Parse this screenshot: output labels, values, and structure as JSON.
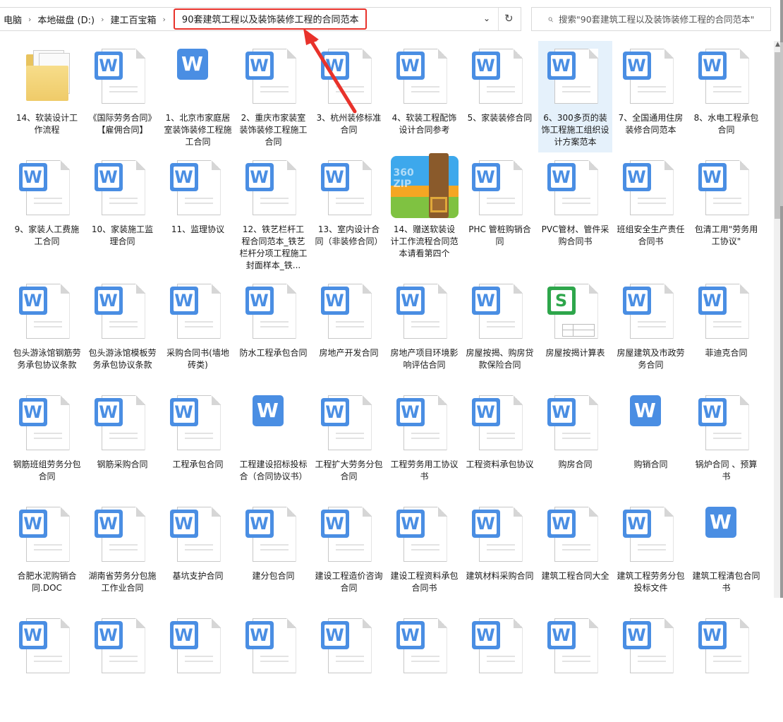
{
  "breadcrumb": [
    {
      "label": "电脑"
    },
    {
      "label": "本地磁盘 (D:)"
    },
    {
      "label": "建工百宝箱"
    }
  ],
  "current_folder": "90套建筑工程以及装饰装修工程的合同范本",
  "search": {
    "placeholder": "搜索\"90套建筑工程以及装饰装修工程的合同范本\""
  },
  "colors": {
    "word_blue": "#4a8ee3",
    "sheet_green": "#2ea64b",
    "highlight_red": "#e8322b",
    "selection": "#e5f1fb"
  },
  "icons": {
    "refresh": "refresh-icon",
    "search": "search-icon",
    "dropdown": "chevron-down-icon"
  },
  "files": [
    {
      "name": "14、软装设计工作流程",
      "type": "folder"
    },
    {
      "name": "《国际劳务合同》【雇佣合同】",
      "type": "doc"
    },
    {
      "name": "1、北京市家庭居室装饰装修工程施工合同",
      "type": "wps"
    },
    {
      "name": "2、重庆市家装室装饰装修工程施工合同",
      "type": "doc"
    },
    {
      "name": "3、杭州装修标准合同",
      "type": "doc"
    },
    {
      "name": "4、软装工程配饰设计合同参考",
      "type": "doc"
    },
    {
      "name": "5、家装装修合同",
      "type": "doc"
    },
    {
      "name": "6、300多页的装饰工程施工组织设计方案范本",
      "type": "doc",
      "selected": true
    },
    {
      "name": "7、全国通用住房装修合同范本",
      "type": "doc"
    },
    {
      "name": "8、水电工程承包合同",
      "type": "doc"
    },
    {
      "name": "9、家装人工费施工合同",
      "type": "doc"
    },
    {
      "name": "10、家装施工监理合同",
      "type": "doc"
    },
    {
      "name": "11、监理协议",
      "type": "doc"
    },
    {
      "name": "12、铁艺栏杆工程合同范本_铁艺栏杆分项工程施工封面样本_铁...",
      "type": "doc"
    },
    {
      "name": "13、室内设计合同（非装修合同）",
      "type": "doc"
    },
    {
      "name": "14、赠送软装设计工作流程合同范本请看第四个",
      "type": "zip"
    },
    {
      "name": "PHC 管桩购销合同",
      "type": "doc"
    },
    {
      "name": "PVC管材、管件采购合同书",
      "type": "doc"
    },
    {
      "name": "班组安全生产责任合同书",
      "type": "doc"
    },
    {
      "name": "包清工用\"劳务用工协议\"",
      "type": "doc"
    },
    {
      "name": "包头游泳馆钢筋劳务承包协议条款",
      "type": "doc"
    },
    {
      "name": "包头游泳馆模板劳务承包协议条款",
      "type": "doc"
    },
    {
      "name": "采购合同书(墙地砖类)",
      "type": "doc"
    },
    {
      "name": "防水工程承包合同",
      "type": "doc"
    },
    {
      "name": "房地产开发合同",
      "type": "doc"
    },
    {
      "name": "房地产项目环境影响评估合同",
      "type": "doc"
    },
    {
      "name": "房屋按揭、购房贷款保险合同",
      "type": "doc"
    },
    {
      "name": "房屋按揭计算表",
      "type": "sheet"
    },
    {
      "name": "房屋建筑及市政劳务合同",
      "type": "doc"
    },
    {
      "name": "菲迪克合同",
      "type": "doc"
    },
    {
      "name": "钢筋班组劳务分包合同",
      "type": "doc"
    },
    {
      "name": "钢筋采购合同",
      "type": "doc"
    },
    {
      "name": "工程承包合同",
      "type": "doc"
    },
    {
      "name": "工程建设招标投标合（合同协议书）",
      "type": "wps"
    },
    {
      "name": "工程扩大劳务分包合同",
      "type": "doc"
    },
    {
      "name": "工程劳务用工协议书",
      "type": "doc"
    },
    {
      "name": "工程资料承包协议",
      "type": "doc"
    },
    {
      "name": "购房合同",
      "type": "doc"
    },
    {
      "name": "购销合同",
      "type": "wps"
    },
    {
      "name": "锅炉合同 、预算书",
      "type": "doc"
    },
    {
      "name": "合肥水泥购销合同.DOC",
      "type": "doc"
    },
    {
      "name": "湖南省劳务分包施工作业合同",
      "type": "doc"
    },
    {
      "name": "基坑支护合同",
      "type": "doc"
    },
    {
      "name": "建分包合同",
      "type": "doc"
    },
    {
      "name": "建设工程造价咨询合同",
      "type": "doc"
    },
    {
      "name": "建设工程资料承包合同书",
      "type": "doc"
    },
    {
      "name": "建筑材料采购合同",
      "type": "doc"
    },
    {
      "name": "建筑工程合同大全",
      "type": "doc"
    },
    {
      "name": "建筑工程劳务分包投标文件",
      "type": "doc"
    },
    {
      "name": "建筑工程清包合同书",
      "type": "wps"
    },
    {
      "name": "",
      "type": "doc"
    },
    {
      "name": "",
      "type": "doc"
    },
    {
      "name": "",
      "type": "doc"
    },
    {
      "name": "",
      "type": "doc"
    },
    {
      "name": "",
      "type": "doc"
    },
    {
      "name": "",
      "type": "doc"
    },
    {
      "name": "",
      "type": "doc"
    },
    {
      "name": "",
      "type": "doc"
    },
    {
      "name": "",
      "type": "doc"
    },
    {
      "name": "",
      "type": "doc"
    }
  ]
}
